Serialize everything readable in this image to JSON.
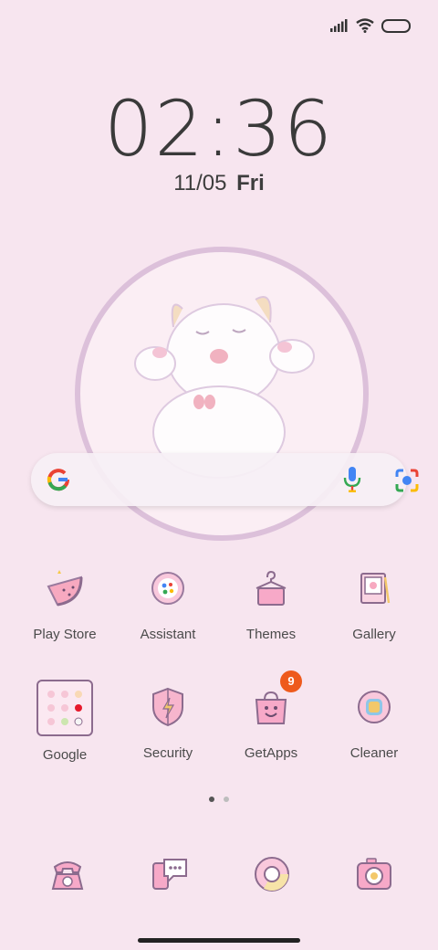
{
  "status": {
    "icons": [
      "signal-icon",
      "wifi-icon",
      "battery-icon"
    ]
  },
  "clock": {
    "time": "02:36"
  },
  "date": {
    "date": "11/05",
    "day": "Fri"
  },
  "widget": {
    "illustration": "sleeping-sheep"
  },
  "search": {
    "icons": [
      "google-icon",
      "mic-icon",
      "lens-icon"
    ]
  },
  "apps": [
    {
      "label": "Play Store"
    },
    {
      "label": "Assistant"
    },
    {
      "label": "Themes"
    },
    {
      "label": "Gallery"
    },
    {
      "label": "Google"
    },
    {
      "label": "Security"
    },
    {
      "label": "GetApps",
      "badge": "9"
    },
    {
      "label": "Cleaner"
    }
  ],
  "dock": [
    "phone-icon",
    "messages-icon",
    "chrome-icon",
    "camera-icon"
  ],
  "pages": {
    "count": 2,
    "current": 1
  },
  "colors": {
    "background": "#f7e5ef",
    "accent": "#c88bc0",
    "badge": "#ee5a1c"
  }
}
